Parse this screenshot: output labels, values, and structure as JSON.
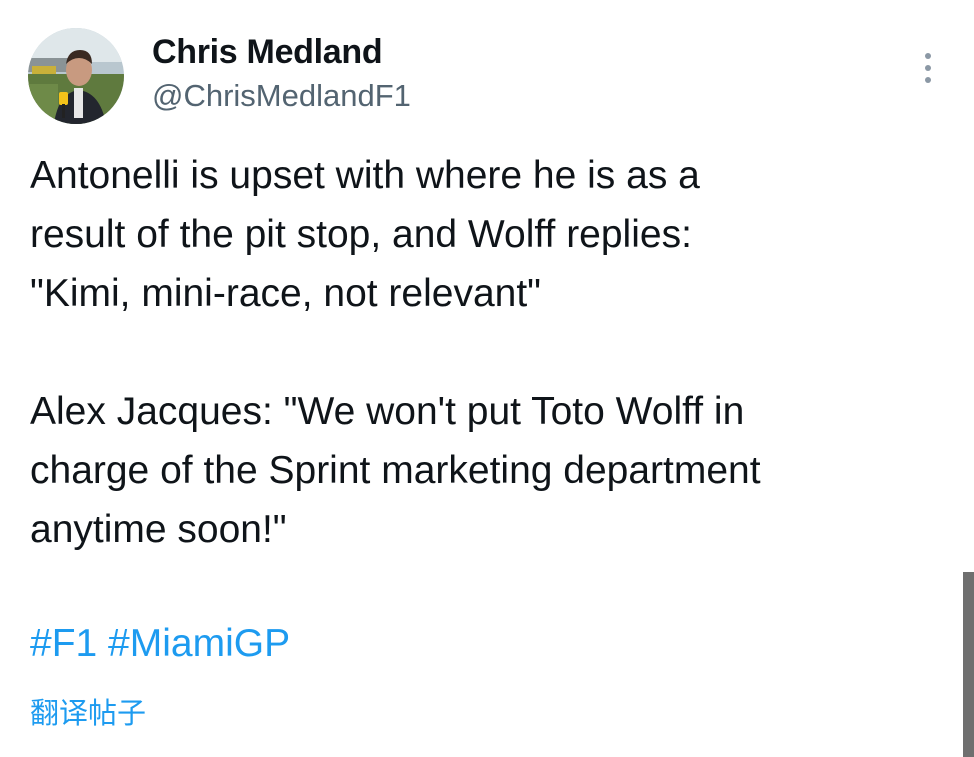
{
  "tweet": {
    "author": {
      "display_name": "Chris Medland",
      "handle": "@ChrisMedlandF1",
      "avatar_icon": "profile-photo"
    },
    "more_icon": "more-vertical-icon",
    "text": "Antonelli is upset with where he is as a\nresult of the pit stop, and Wolff replies:\n\"Kimi, mini-race, not relevant\"\n\nAlex Jacques: \"We won't put Toto Wolff in\ncharge of the Sprint marketing department\nanytime soon!\"",
    "hashtags": [
      "#F1",
      "#MiamiGP"
    ],
    "translate_label": "翻译帖子"
  },
  "colors": {
    "text": "#0f1419",
    "secondary": "#536471",
    "link": "#1d9bf0",
    "background": "#ffffff"
  }
}
